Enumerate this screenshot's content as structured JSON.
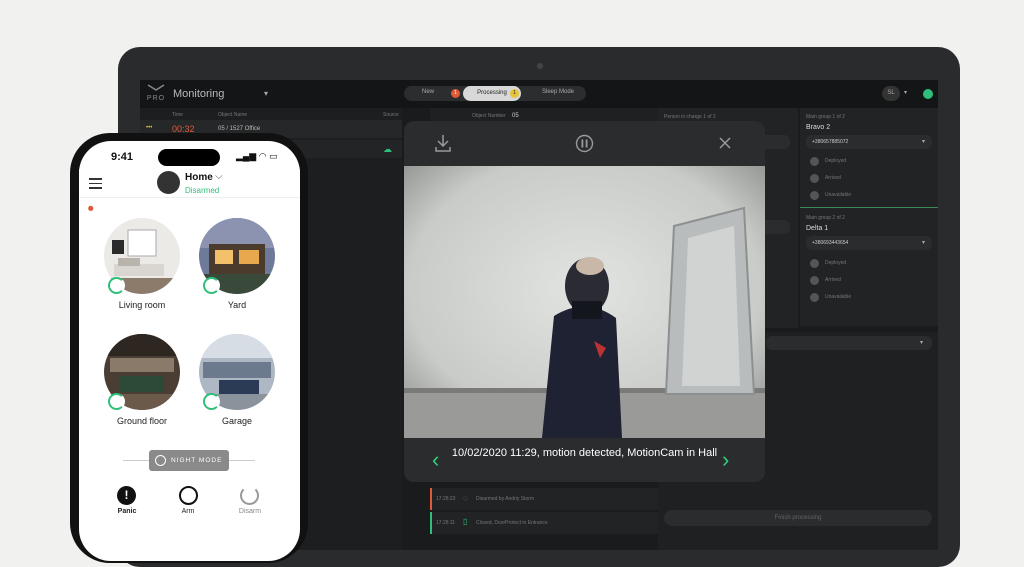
{
  "laptop": {
    "app_title": "Monitoring",
    "logo_text": "PRO",
    "tabs": [
      {
        "label": "New",
        "badge": "1"
      },
      {
        "label": "Processing",
        "badge": "1"
      },
      {
        "label": "Sleep Mode"
      }
    ],
    "user_initials": "SL",
    "table": {
      "headers": [
        "",
        "Time",
        "Object Name",
        "Source"
      ],
      "row": {
        "dots": "•••",
        "time": "00:32",
        "object": "05 / 1527 Office"
      }
    },
    "object_number_label": "Object Number",
    "object_number": "05",
    "person_in_charge": "Person in charge 1 of 2",
    "groups": [
      {
        "title": "Main group 1 of 2",
        "name": "Bravo 2",
        "phone": "+380657885072",
        "statuses": [
          "Deployed",
          "Arrived",
          "Unavailable"
        ]
      },
      {
        "title": "Main group 2 of 2",
        "name": "Delta 1",
        "phone": "+380693443654",
        "statuses": [
          "Deployed",
          "Arrived",
          "Unavailable"
        ]
      }
    ],
    "log": [
      {
        "time": "17:28:23",
        "text": "Disarmed by Andriy Storm"
      },
      {
        "time": "17:28:11",
        "text": "Closed, DoorProtect in Entrance"
      }
    ],
    "finish_label": "Finish processing"
  },
  "popup": {
    "caption": "10/02/2020 11:29, motion detected, MotionCam in Hall"
  },
  "phone": {
    "time": "9:41",
    "hub_name": "Home",
    "hub_status": "Disarmed",
    "rooms": [
      {
        "label": "Living room"
      },
      {
        "label": "Yard"
      },
      {
        "label": "Ground floor"
      },
      {
        "label": "Garage"
      }
    ],
    "night_mode": "NIGHT MODE",
    "actions": [
      {
        "label": "Panic"
      },
      {
        "label": "Arm"
      },
      {
        "label": "Disarm"
      }
    ]
  },
  "colors": {
    "accent_green": "#2fd37a",
    "status_green": "#2fbf7a",
    "alert_red": "#e05a3a"
  }
}
